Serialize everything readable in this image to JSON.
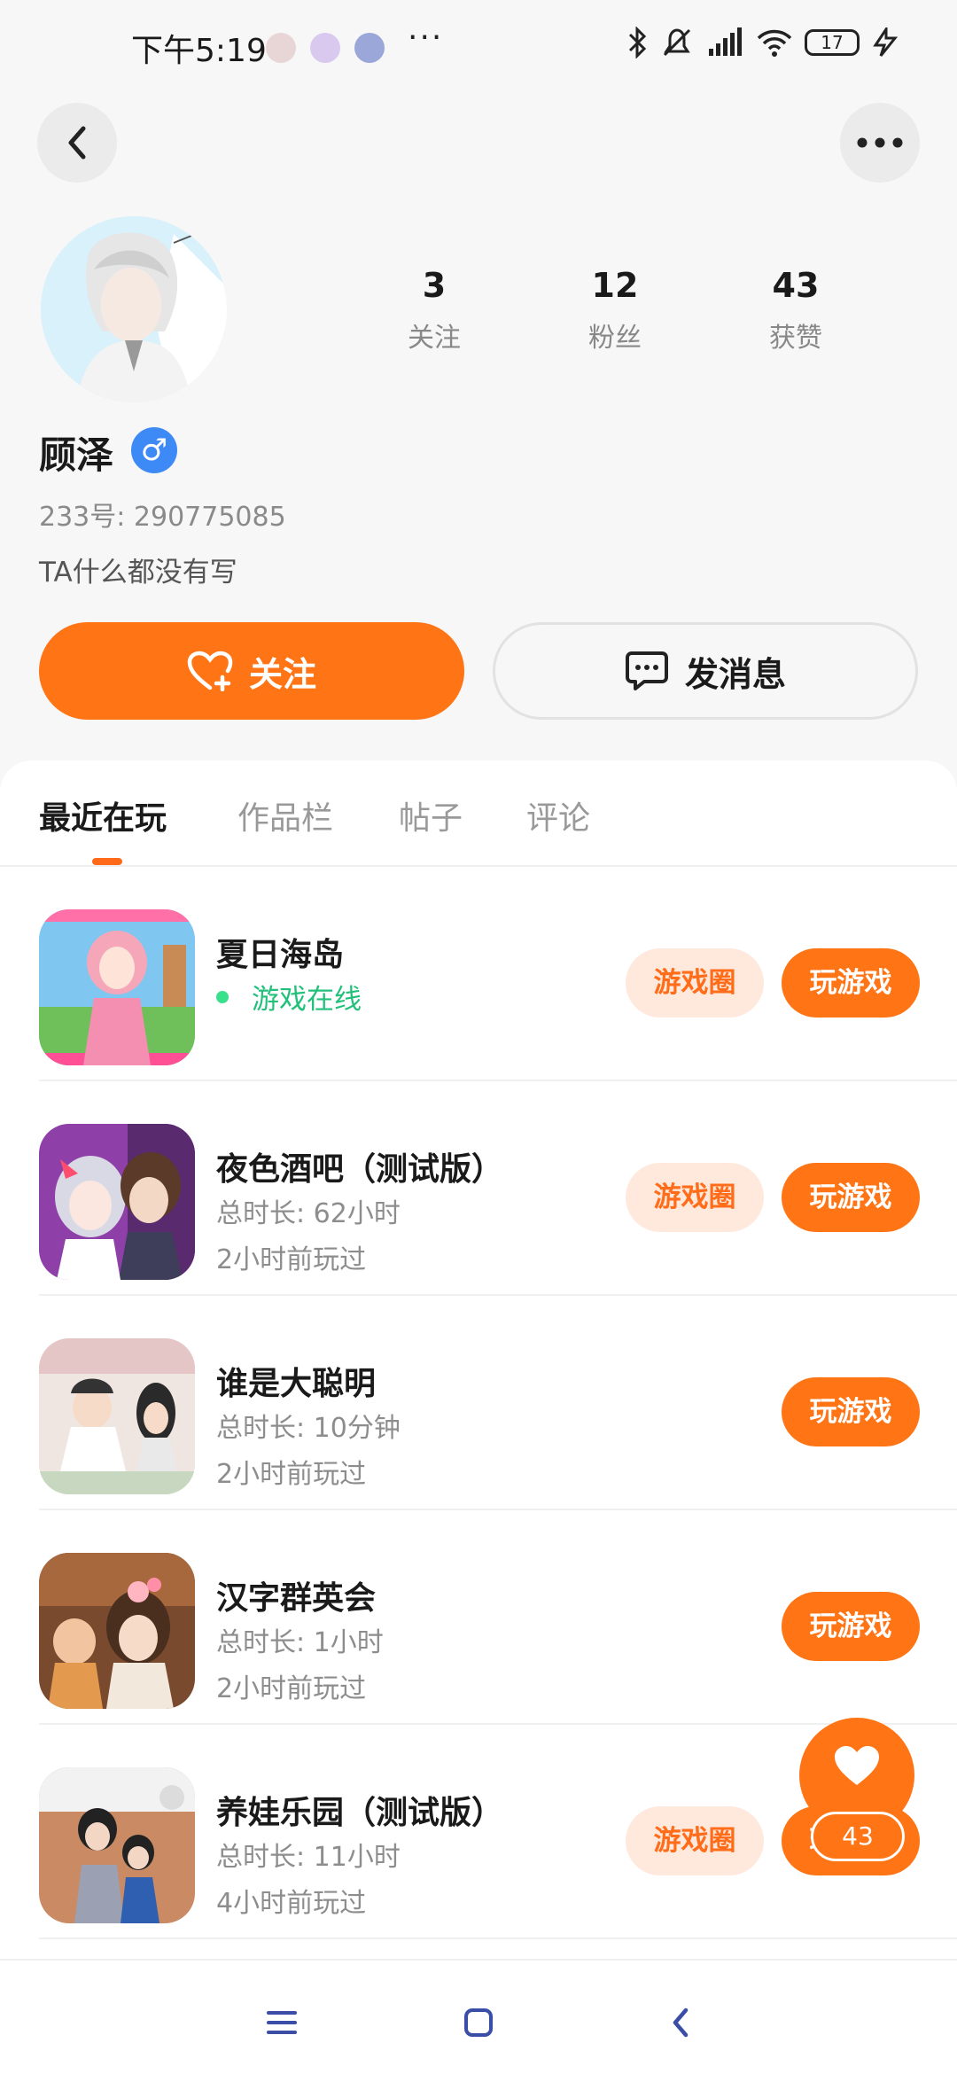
{
  "status_bar": {
    "time": "下午5:19",
    "more": "···",
    "battery": "17"
  },
  "profile": {
    "name": "顾泽",
    "gender_symbol": "♂",
    "id_text": "233号: 290775085",
    "bio": "TA什么都没有写",
    "stats": [
      {
        "value": "3",
        "label": "关注"
      },
      {
        "value": "12",
        "label": "粉丝"
      },
      {
        "value": "43",
        "label": "获赞"
      }
    ]
  },
  "actions": {
    "follow": "关注",
    "message": "发消息"
  },
  "tabs": [
    "最近在玩",
    "作品栏",
    "帖子",
    "评论"
  ],
  "games": [
    {
      "name": "夏日海岛",
      "status": "游戏在线",
      "circle": "游戏圈",
      "play": "玩游戏"
    },
    {
      "name": "夜色酒吧（测试版）",
      "duration": "总时长: 62小时",
      "last": "2小时前玩过",
      "circle": "游戏圈",
      "play": "玩游戏"
    },
    {
      "name": "谁是大聪明",
      "duration": "总时长: 10分钟",
      "last": "2小时前玩过",
      "play": "玩游戏"
    },
    {
      "name": "汉字群英会",
      "duration": "总时长: 1小时",
      "last": "2小时前玩过",
      "play": "玩游戏"
    },
    {
      "name": "养娃乐园（测试版）",
      "duration": "总时长: 11小时",
      "last": "4小时前玩过",
      "circle": "游戏圈",
      "play": "玩游戏"
    }
  ],
  "like_fab": {
    "count": "43"
  },
  "colors": {
    "accent": "#ff7414",
    "online": "#22c07a",
    "gender": "#3d8af7"
  }
}
